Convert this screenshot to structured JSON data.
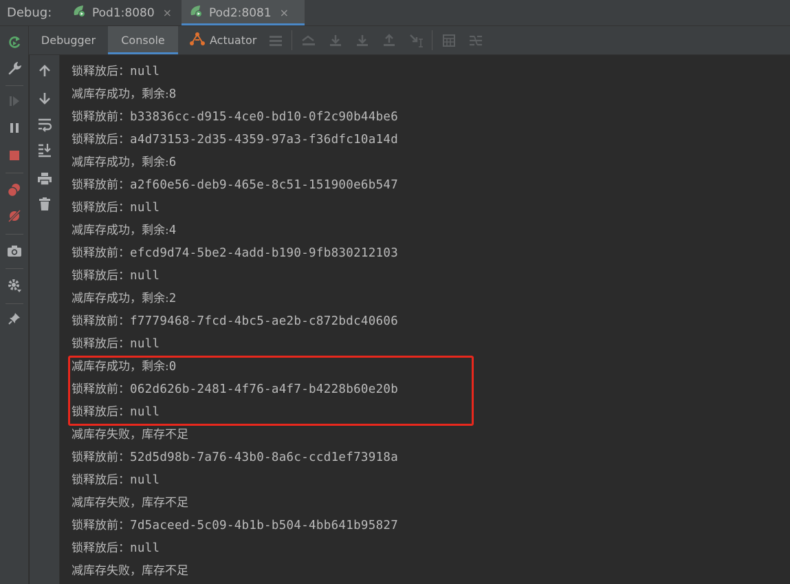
{
  "topbar": {
    "label": "Debug:",
    "tabs": [
      {
        "label": "Pod1:8080",
        "icon": "spring-run-icon",
        "close": "×"
      },
      {
        "label": "Pod2:8081",
        "icon": "spring-run-icon",
        "close": "×"
      }
    ]
  },
  "toolbar": {
    "tabs": [
      {
        "label": "Debugger"
      },
      {
        "label": "Console"
      },
      {
        "label": "Actuator"
      }
    ]
  },
  "log": [
    {
      "prefix": "锁释放后：",
      "value": "null"
    },
    {
      "prefix": "减库存成功，剩余:",
      "value": "8"
    },
    {
      "prefix": "锁释放前：",
      "value": "b33836cc-d915-4ce0-bd10-0f2c90b44be6"
    },
    {
      "prefix": "锁释放后：",
      "value": "a4d73153-2d35-4359-97a3-f36dfc10a14d"
    },
    {
      "prefix": "减库存成功，剩余:",
      "value": "6"
    },
    {
      "prefix": "锁释放前：",
      "value": "a2f60e56-deb9-465e-8c51-151900e6b547"
    },
    {
      "prefix": "锁释放后：",
      "value": "null"
    },
    {
      "prefix": "减库存成功，剩余:",
      "value": "4"
    },
    {
      "prefix": "锁释放前：",
      "value": "efcd9d74-5be2-4add-b190-9fb830212103"
    },
    {
      "prefix": "锁释放后：",
      "value": "null"
    },
    {
      "prefix": "减库存成功，剩余:",
      "value": "2"
    },
    {
      "prefix": "锁释放前：",
      "value": "f7779468-7fcd-4bc5-ae2b-c872bdc40606"
    },
    {
      "prefix": "锁释放后：",
      "value": "null"
    },
    {
      "prefix": "减库存成功，剩余:",
      "value": "0"
    },
    {
      "prefix": "锁释放前：",
      "value": "062d626b-2481-4f76-a4f7-b4228b60e20b"
    },
    {
      "prefix": "锁释放后：",
      "value": "null"
    },
    {
      "prefix": "减库存失败，库存不足",
      "value": ""
    },
    {
      "prefix": "锁释放前：",
      "value": "52d5d98b-7a76-43b0-8a6c-ccd1ef73918a"
    },
    {
      "prefix": "锁释放后：",
      "value": "null"
    },
    {
      "prefix": "减库存失败，库存不足",
      "value": ""
    },
    {
      "prefix": "锁释放前：",
      "value": "7d5aceed-5c09-4b1b-b504-4bb641b95827"
    },
    {
      "prefix": "锁释放后：",
      "value": "null"
    },
    {
      "prefix": "减库存失败，库存不足",
      "value": ""
    }
  ],
  "colors": {
    "highlight": "#e8281d",
    "accent": "#4a88c7"
  }
}
